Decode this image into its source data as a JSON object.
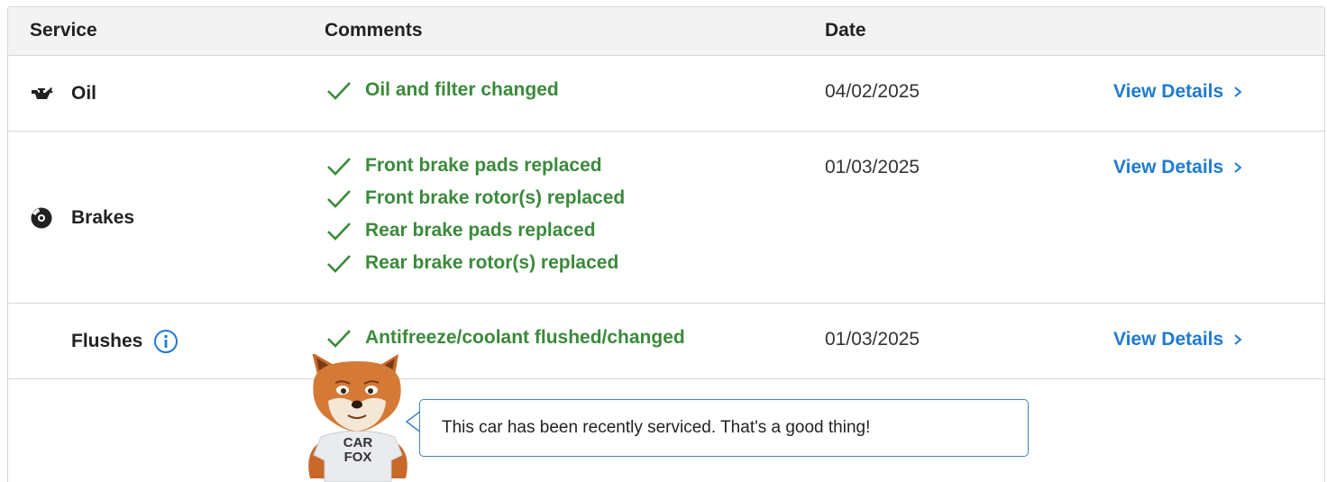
{
  "header": {
    "service": "Service",
    "comments": "Comments",
    "date": "Date"
  },
  "rows": [
    {
      "service": "Oil",
      "icon": "oil-can-icon",
      "comments": [
        "Oil and filter changed"
      ],
      "date": "04/02/2025",
      "link": "View Details"
    },
    {
      "service": "Brakes",
      "icon": "brake-disc-icon",
      "comments": [
        "Front brake pads replaced",
        "Front brake rotor(s) replaced",
        "Rear brake pads replaced",
        "Rear brake rotor(s) replaced"
      ],
      "date": "01/03/2025",
      "link": "View Details"
    },
    {
      "service": "Flushes",
      "icon": "info-icon",
      "comments": [
        "Antifreeze/coolant flushed/changed"
      ],
      "date": "01/03/2025",
      "link": "View Details"
    }
  ],
  "fox": {
    "shirt_line1": "CAR",
    "shirt_line2": "FOX",
    "message": "This car has been recently serviced. That's a good thing!"
  },
  "colors": {
    "accent_link": "#1f7ad0",
    "comment_green": "#3a8a3a",
    "bubble_border": "#3b82c8"
  }
}
